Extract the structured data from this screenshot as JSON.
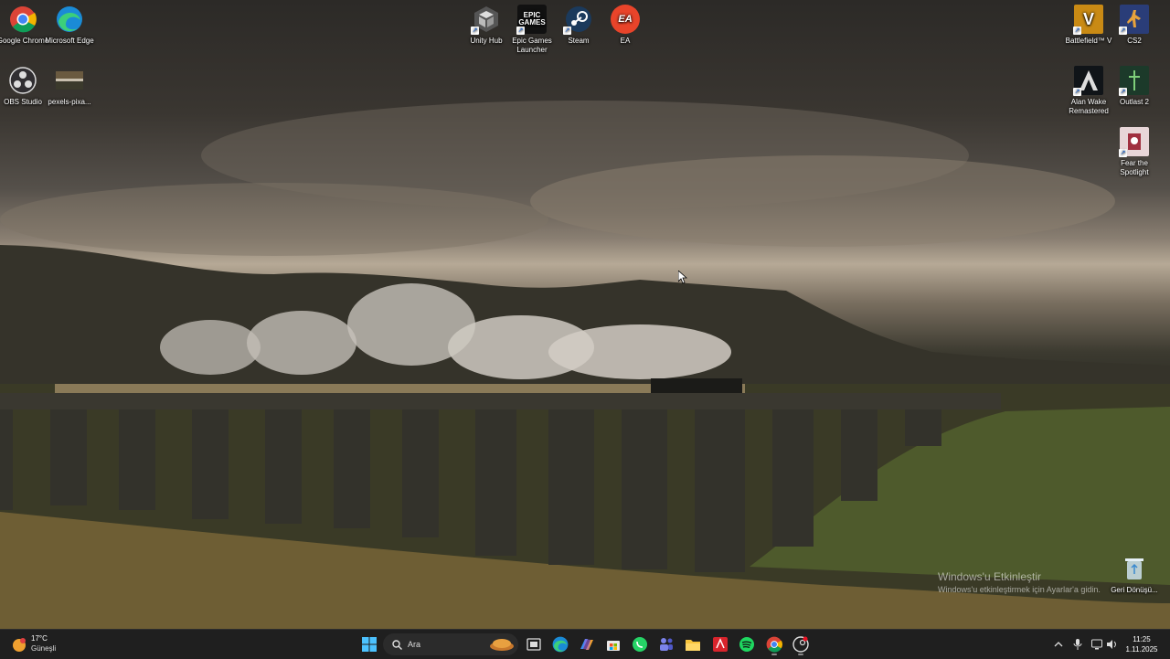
{
  "desktop": {
    "left_icons": [
      {
        "label": "Google Chrome",
        "icon": "chrome-icon"
      },
      {
        "label": "Microsoft Edge",
        "icon": "edge-icon"
      },
      {
        "label": "OBS Studio",
        "icon": "obs-icon"
      },
      {
        "label": "pexels-pixa...",
        "icon": "image-file-icon"
      }
    ],
    "top_icons": [
      {
        "label": "Unity Hub",
        "icon": "unity-icon"
      },
      {
        "label": "Epic Games Launcher",
        "icon": "epic-games-icon"
      },
      {
        "label": "Steam",
        "icon": "steam-icon"
      },
      {
        "label": "EA",
        "icon": "ea-icon"
      }
    ],
    "right_icons": [
      {
        "label": "Battlefield™ V",
        "icon": "battlefield-icon"
      },
      {
        "label": "CS2",
        "icon": "cs2-icon"
      },
      {
        "label": "Alan Wake Remastered",
        "icon": "alan-wake-icon"
      },
      {
        "label": "Outlast 2",
        "icon": "outlast-icon"
      },
      {
        "label": "Fear the Spotlight",
        "icon": "fear-spotlight-icon"
      },
      {
        "label": "Geri Dönüşü...",
        "icon": "recycle-bin-icon"
      }
    ],
    "epic_logo_text": "EPIC\nGAMES",
    "ea_logo_text": "EA",
    "battlefield_logo_text": "V",
    "activation": {
      "title": "Windows'u Etkinleştir",
      "subtitle": "Windows'u etkinleştirmek için Ayarlar'a gidin."
    }
  },
  "taskbar": {
    "weather": {
      "temp": "17°C",
      "condition": "Güneşli"
    },
    "search_placeholder": "Ara",
    "apps": [
      "start-icon",
      "search-icon",
      "task-view-icon",
      "edge-icon",
      "copilot-icon",
      "store-icon",
      "whatsapp-icon",
      "teams-icon",
      "file-explorer-icon",
      "acrobat-icon",
      "spotify-icon",
      "chrome-icon",
      "steam-like-icon"
    ],
    "clock": {
      "time": "11:25",
      "date": "1.11.2025"
    }
  },
  "colors": {
    "taskbar_bg": "#1f1f1f",
    "accent": "#0078d4"
  }
}
